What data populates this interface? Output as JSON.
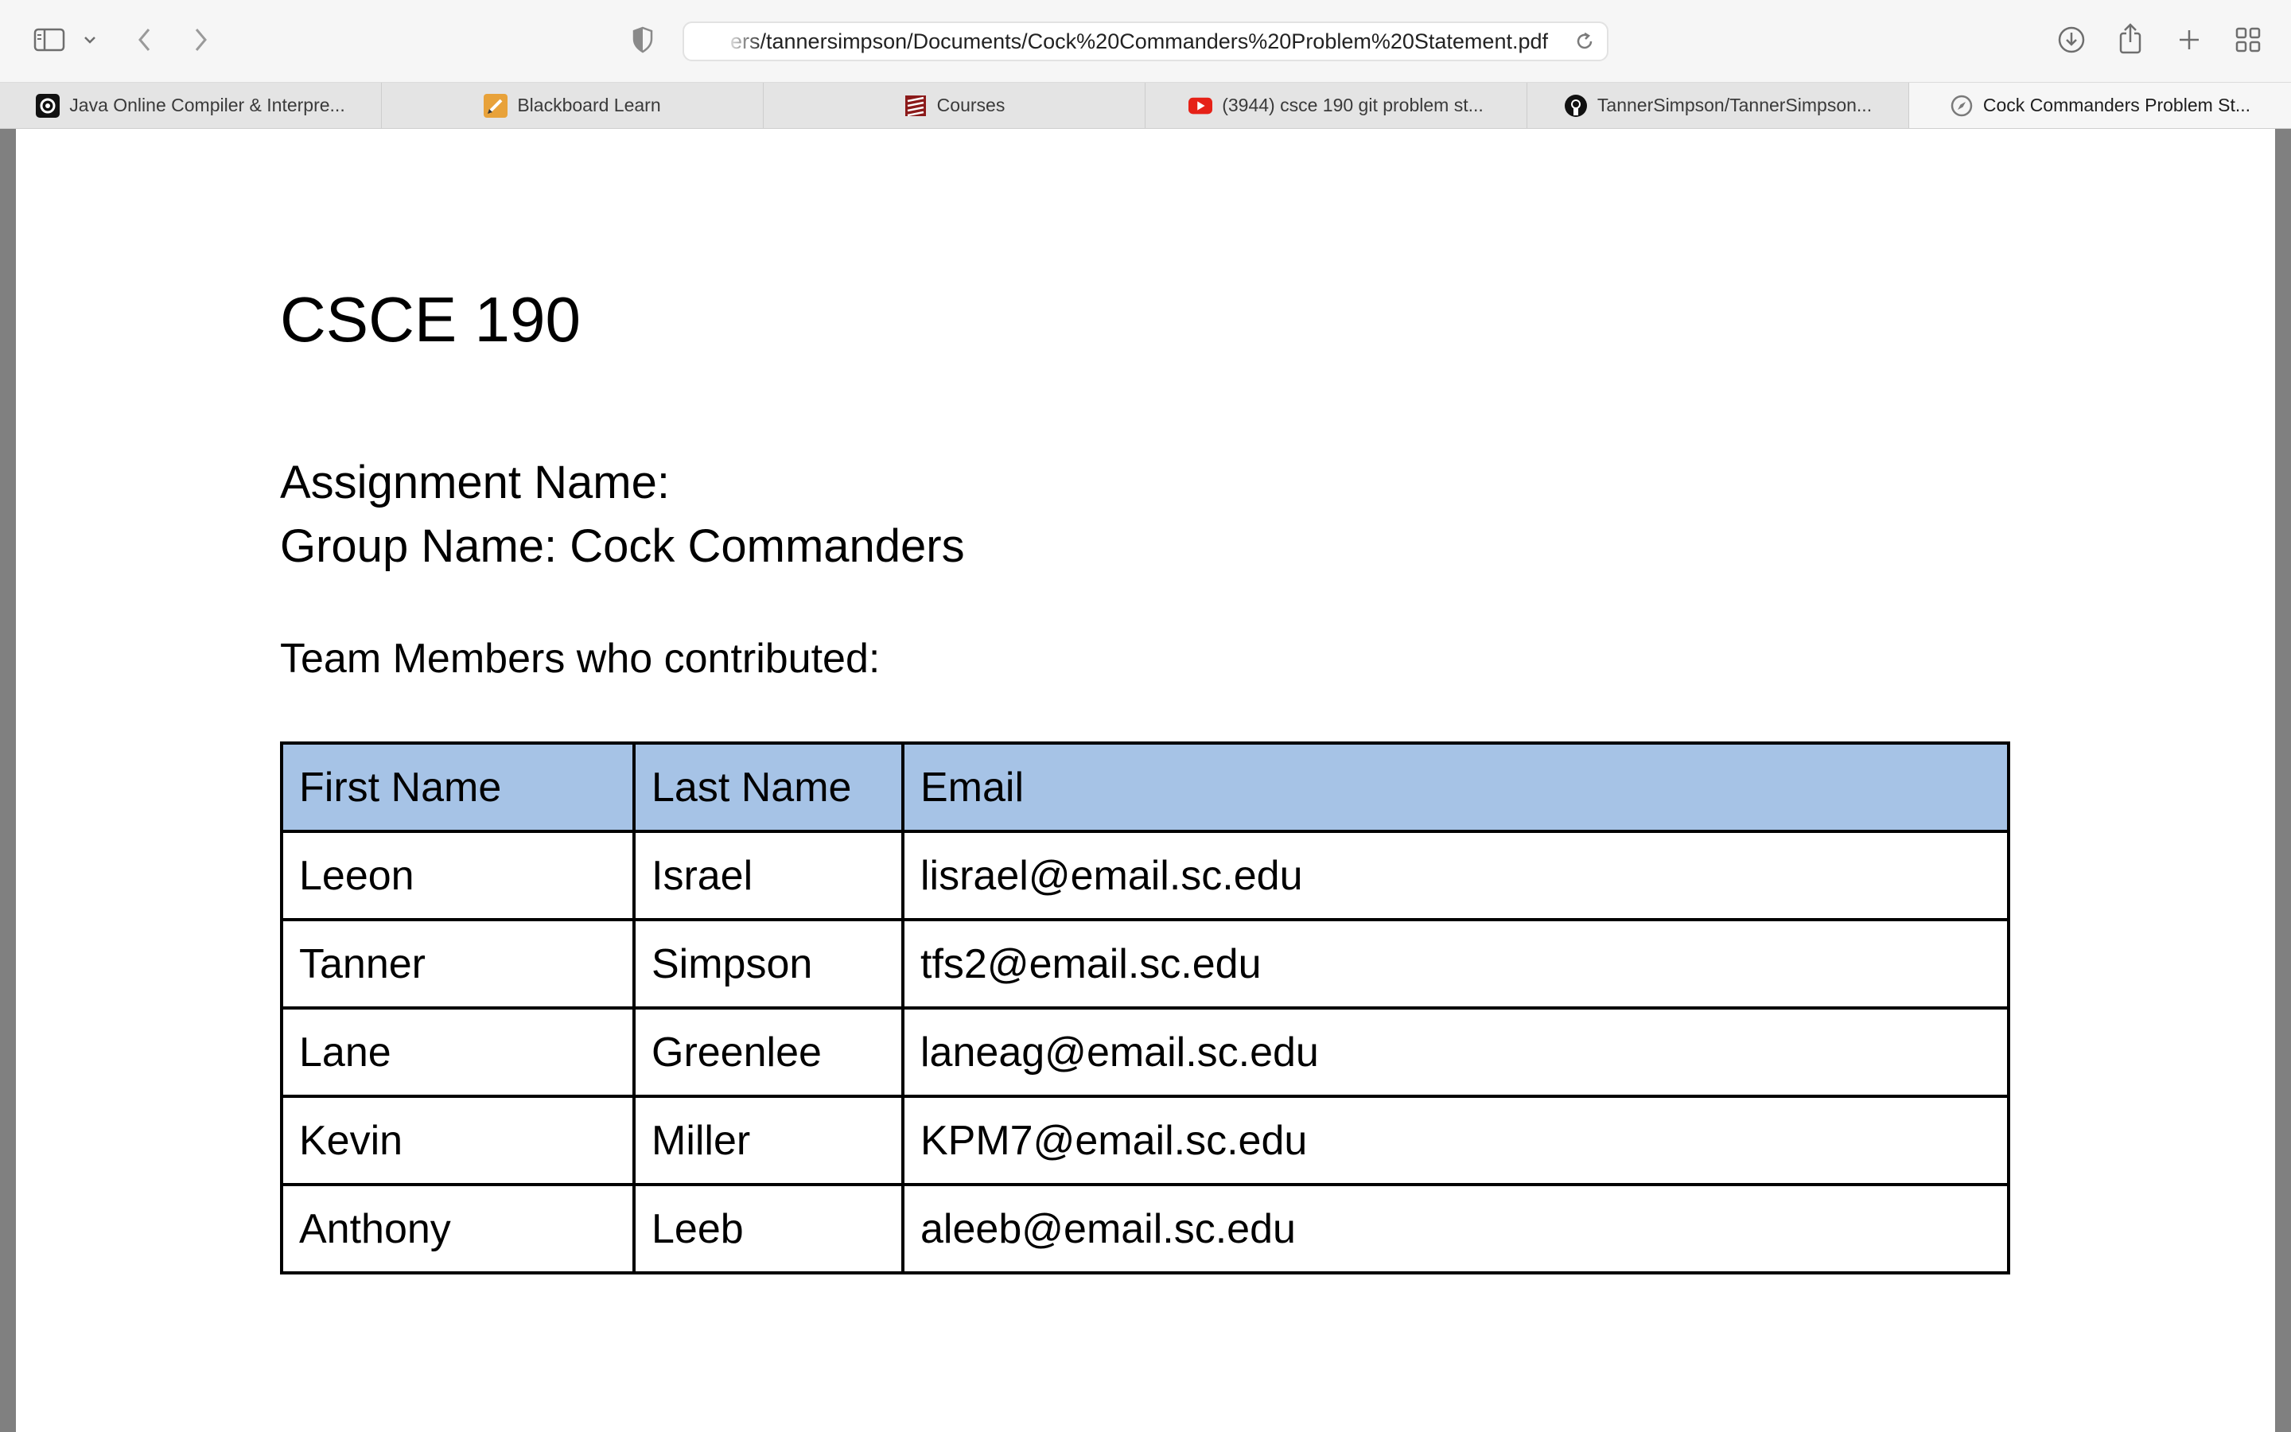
{
  "browser": {
    "url": "ers/tannersimpson/Documents/Cock%20Commanders%20Problem%20Statement.pdf",
    "tabs": [
      {
        "title": "Java Online Compiler & Interpre...",
        "icon": "java-compiler-favicon",
        "active": false
      },
      {
        "title": "Blackboard Learn",
        "icon": "blackboard-favicon",
        "active": false
      },
      {
        "title": "Courses",
        "icon": "courses-favicon",
        "active": false
      },
      {
        "title": "(3944) csce 190 git problem st...",
        "icon": "youtube-favicon",
        "active": false
      },
      {
        "title": "TannerSimpson/TannerSimpson...",
        "icon": "github-favicon",
        "active": false
      },
      {
        "title": "Cock Commanders Problem St...",
        "icon": "compass-favicon",
        "active": true
      }
    ]
  },
  "document": {
    "title": "CSCE 190",
    "assignment_label": "Assignment Name:",
    "group_label": "Group Name: Cock Commanders",
    "team_label": "Team Members who contributed:",
    "table": {
      "headers": [
        "First Name",
        "Last Name",
        "Email"
      ],
      "rows": [
        [
          "Leeon",
          "Israel",
          "lisrael@email.sc.edu"
        ],
        [
          "Tanner",
          "Simpson",
          "tfs2@email.sc.edu"
        ],
        [
          "Lane",
          "Greenlee",
          "laneag@email.sc.edu"
        ],
        [
          "Kevin",
          "Miller",
          "KPM7@email.sc.edu"
        ],
        [
          "Anthony",
          "Leeb",
          "aleeb@email.sc.edu"
        ]
      ]
    }
  },
  "colors": {
    "header_fill": "#a6c3e6",
    "chrome_bg": "#f6f6f6",
    "viewer_bg": "#808080"
  }
}
